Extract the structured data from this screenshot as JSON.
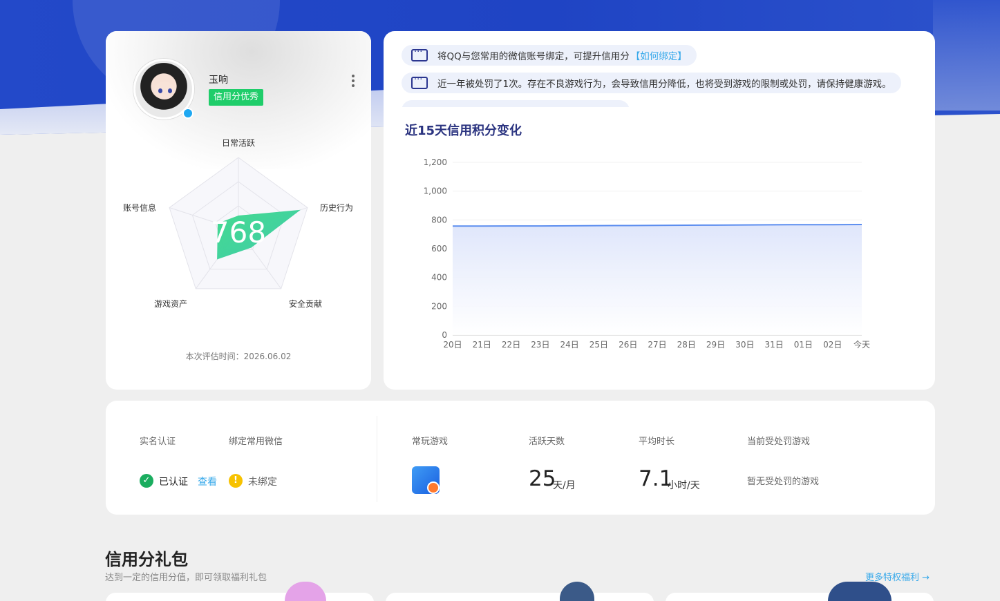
{
  "profile": {
    "username": "玉响",
    "credit_level": "信用分优秀",
    "score": "768",
    "radar_labels": [
      "日常活跃",
      "历史行为",
      "安全贡献",
      "游戏资产",
      "账号信息"
    ],
    "radar_values": [
      0.2,
      0.9,
      0.3,
      0.5,
      0.3
    ],
    "eval_time": "本次评估时间：2026.06.02"
  },
  "notices": [
    {
      "text": "将QQ与您常用的微信账号绑定，可提升信用分",
      "link": "【如何绑定】"
    },
    {
      "text": "近一年被处罚了1次。存在不良游戏行为，会导致信用分降低，也将受到游戏的限制或处罚，请保持健康游戏。",
      "link": ""
    }
  ],
  "chart_title": "近15天信用积分变化",
  "chart_data": {
    "type": "area",
    "title": "近15天信用积分变化",
    "x": [
      "20日",
      "21日",
      "22日",
      "23日",
      "24日",
      "25日",
      "26日",
      "27日",
      "28日",
      "29日",
      "30日",
      "31日",
      "01日",
      "02日",
      "今天"
    ],
    "series": [
      {
        "values": [
          757,
          757,
          758,
          758,
          759,
          760,
          761,
          762,
          763,
          764,
          765,
          766,
          767,
          767,
          768
        ]
      }
    ],
    "yticks": [
      0,
      200,
      400,
      600,
      800,
      1000,
      1200
    ],
    "ytick_labels": [
      "0",
      "200",
      "400",
      "600",
      "800",
      "1,000",
      "1,200"
    ],
    "ylim": [
      0,
      1200
    ],
    "grid": true,
    "colors": {
      "line": "#5b8def",
      "fill_top": "#dfe6fb"
    }
  },
  "stats": {
    "realname_label": "实名认证",
    "wechat_label": "绑定常用微信",
    "realname_status": "已认证",
    "view_link": "查看",
    "wechat_status": "未绑定",
    "game_label": "常玩游戏",
    "active_label": "活跃天数",
    "active_value": "25",
    "active_unit": "天/月",
    "avg_label": "平均时长",
    "avg_value": "7.1",
    "avg_unit": "小时/天",
    "punish_label": "当前受处罚游戏",
    "punish_value": "暂无受处罚的游戏"
  },
  "gift": {
    "title": "信用分礼包",
    "subtitle": "达到一定的信用分值，即可领取福利礼包",
    "more": "更多特权福利 →"
  },
  "colors": {
    "brand_blue": "#2349c9",
    "green": "#1fcd6a",
    "link": "#35a8ea",
    "title_navy": "#2b3480"
  }
}
